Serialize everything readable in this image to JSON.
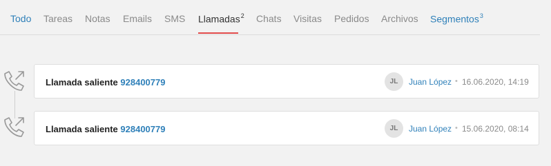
{
  "tabs": [
    {
      "label": "Todo",
      "count": ""
    },
    {
      "label": "Tareas",
      "count": ""
    },
    {
      "label": "Notas",
      "count": ""
    },
    {
      "label": "Emails",
      "count": ""
    },
    {
      "label": "SMS",
      "count": ""
    },
    {
      "label": "Llamadas",
      "count": "2"
    },
    {
      "label": "Chats",
      "count": ""
    },
    {
      "label": "Visitas",
      "count": ""
    },
    {
      "label": "Pedidos",
      "count": ""
    },
    {
      "label": "Archivos",
      "count": ""
    },
    {
      "label": "Segmentos",
      "count": "3"
    }
  ],
  "active_tab": "Llamadas",
  "colors": {
    "link": "#2f80b9",
    "active_underline": "#e24b4b"
  },
  "icons": {
    "call": "outgoing-call-icon"
  },
  "calls": [
    {
      "title": "Llamada saliente",
      "number": "928400779",
      "avatar_initials": "JL",
      "author": "Juan López",
      "date": "16.06.2020, 14:19"
    },
    {
      "title": "Llamada saliente",
      "number": "928400779",
      "avatar_initials": "JL",
      "author": "Juan López",
      "date": "15.06.2020, 08:14"
    }
  ]
}
